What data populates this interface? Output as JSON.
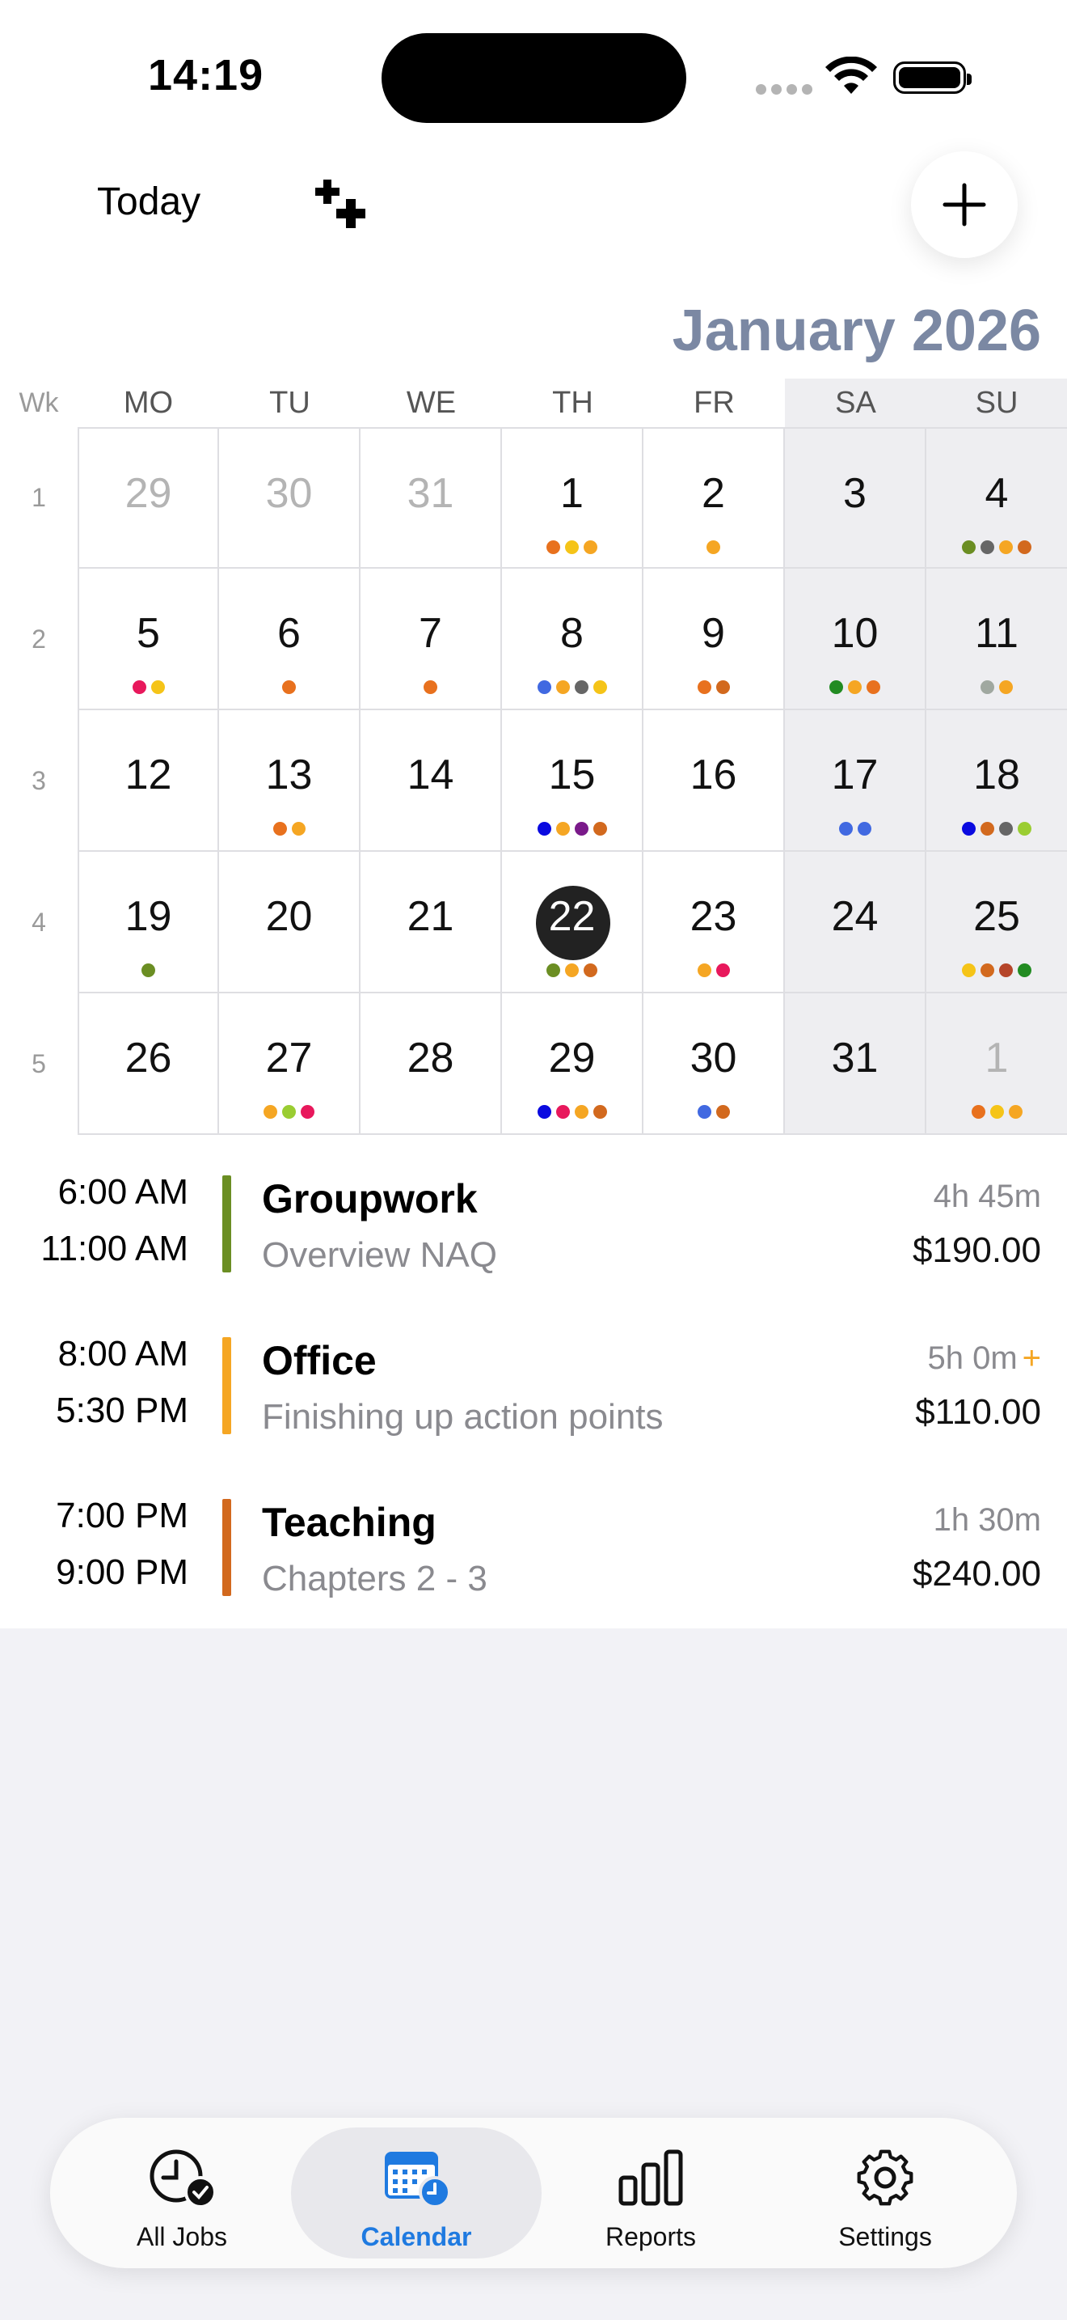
{
  "status_bar": {
    "time": "14:19"
  },
  "toolbar": {
    "today_label": "Today"
  },
  "calendar": {
    "month_title": "January 2026",
    "week_header": "Wk",
    "day_headers": [
      "MO",
      "TU",
      "WE",
      "TH",
      "FR",
      "SA",
      "SU"
    ],
    "weeks": [
      {
        "wk": "1",
        "days": [
          {
            "n": "29",
            "muted": true,
            "dots": []
          },
          {
            "n": "30",
            "muted": true,
            "dots": []
          },
          {
            "n": "31",
            "muted": true,
            "dots": []
          },
          {
            "n": "1",
            "dots": [
              "#e8711e",
              "#f5c418",
              "#f5a623"
            ]
          },
          {
            "n": "2",
            "dots": [
              "#f5a623"
            ]
          },
          {
            "n": "3",
            "dots": []
          },
          {
            "n": "4",
            "dots": [
              "#6b8e23",
              "#666666",
              "#f5a623",
              "#d2691e"
            ]
          }
        ]
      },
      {
        "wk": "2",
        "days": [
          {
            "n": "5",
            "dots": [
              "#e8185c",
              "#f5c418"
            ]
          },
          {
            "n": "6",
            "dots": [
              "#e8711e"
            ]
          },
          {
            "n": "7",
            "dots": [
              "#e8711e"
            ]
          },
          {
            "n": "8",
            "dots": [
              "#4169e1",
              "#f5a623",
              "#666666",
              "#f5c418"
            ]
          },
          {
            "n": "9",
            "dots": [
              "#e8711e",
              "#d2691e"
            ]
          },
          {
            "n": "10",
            "dots": [
              "#228b22",
              "#f5a623",
              "#e8711e"
            ]
          },
          {
            "n": "11",
            "dots": [
              "#a0a8a0",
              "#f5a623"
            ]
          }
        ]
      },
      {
        "wk": "3",
        "days": [
          {
            "n": "12",
            "dots": []
          },
          {
            "n": "13",
            "dots": [
              "#e8711e",
              "#f5a623"
            ]
          },
          {
            "n": "14",
            "dots": []
          },
          {
            "n": "15",
            "dots": [
              "#0a0ae0",
              "#f5a623",
              "#7a1a8a",
              "#d2691e"
            ]
          },
          {
            "n": "16",
            "dots": []
          },
          {
            "n": "17",
            "dots": [
              "#4169e1",
              "#4169e1"
            ]
          },
          {
            "n": "18",
            "dots": [
              "#0a0ae0",
              "#d2691e",
              "#666666",
              "#9acd32"
            ]
          }
        ]
      },
      {
        "wk": "4",
        "days": [
          {
            "n": "19",
            "dots": [
              "#6b8e23"
            ]
          },
          {
            "n": "20",
            "dots": []
          },
          {
            "n": "21",
            "dots": []
          },
          {
            "n": "22",
            "today": true,
            "dots": [
              "#6b8e23",
              "#f5a623",
              "#d2691e"
            ]
          },
          {
            "n": "23",
            "dots": [
              "#f5a623",
              "#e8185c"
            ]
          },
          {
            "n": "24",
            "dots": []
          },
          {
            "n": "25",
            "dots": [
              "#f5c418",
              "#d2691e",
              "#b5452a",
              "#228b22"
            ]
          }
        ]
      },
      {
        "wk": "5",
        "days": [
          {
            "n": "26",
            "dots": []
          },
          {
            "n": "27",
            "dots": [
              "#f5a623",
              "#9acd32",
              "#e8185c"
            ]
          },
          {
            "n": "28",
            "dots": []
          },
          {
            "n": "29",
            "dots": [
              "#0a0ae0",
              "#e8185c",
              "#f5a623",
              "#d2691e"
            ]
          },
          {
            "n": "30",
            "dots": [
              "#4169e1",
              "#d2691e"
            ]
          },
          {
            "n": "31",
            "dots": []
          },
          {
            "n": "1",
            "muted": true,
            "dots": [
              "#e8711e",
              "#f5c418",
              "#f5a623"
            ]
          }
        ]
      }
    ]
  },
  "events": [
    {
      "start": "6:00 AM",
      "end": "11:00 AM",
      "title": "Groupwork",
      "subtitle": "Overview NAQ",
      "duration": "4h 45m",
      "amount": "$190.00",
      "color": "#6b8e23",
      "plus": ""
    },
    {
      "start": "8:00 AM",
      "end": "5:30 PM",
      "title": "Office",
      "subtitle": "Finishing up action points",
      "duration": "5h 0m",
      "amount": "$110.00",
      "color": "#f5a623",
      "plus": "+"
    },
    {
      "start": "7:00 PM",
      "end": "9:00 PM",
      "title": "Teaching",
      "subtitle": "Chapters 2 - 3",
      "duration": "1h 30m",
      "amount": "$240.00",
      "color": "#d2691e",
      "plus": ""
    }
  ],
  "tabbar": {
    "tabs": [
      {
        "label": "All Jobs",
        "icon": "clock-check-icon"
      },
      {
        "label": "Calendar",
        "icon": "calendar-clock-icon",
        "active": true
      },
      {
        "label": "Reports",
        "icon": "bar-chart-icon"
      },
      {
        "label": "Settings",
        "icon": "gear-icon"
      }
    ]
  },
  "colors": {
    "accent": "#1f7ae0",
    "month_title": "#7b88a3",
    "today_circle": "#222222"
  }
}
